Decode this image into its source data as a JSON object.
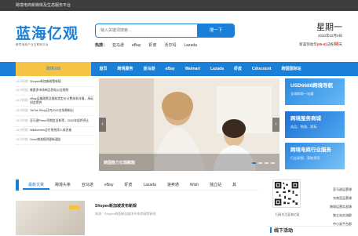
{
  "topbar": {
    "text": "跨境电商新媒体及生态服务平台"
  },
  "logo": {
    "title": "蓝海亿观",
    "subtitle": "跨境电商产业互联网平台"
  },
  "search": {
    "placeholder": "输入关键词搜索...",
    "button": "搜一下"
  },
  "hot": {
    "label": "热搜：",
    "items": [
      "亚马逊",
      "eBay",
      "虾皮",
      "沃尔玛",
      "Lazada"
    ]
  },
  "date": {
    "weekday": "星期一",
    "date": "2020年02月0日",
    "rate_prefix": "新美弥动华",
    "rate_code": "(65-6)",
    "rate_mid": "记各",
    "rate_num": "88",
    "rate_suffix": "天"
  },
  "nav": {
    "category": "跨境168",
    "items": [
      "首页",
      "跨境服务",
      "亚马逊",
      "eBay",
      "Walmart",
      "Lazada",
      "虾皮",
      "Cdiscount",
      "跨国国际站"
    ]
  },
  "leftlist": [
    {
      "time": "13小时前",
      "text": "Shopee新加坡政策新规"
    },
    {
      "time": "13小时前",
      "text": "美客多市场新品到站公告规则"
    },
    {
      "time": "13小时前",
      "text": "eBay运输政策及限制类定价计费体系详情，承诺如会提供"
    },
    {
      "time": "13小时前",
      "text": "TikTok Shop日内2022全场税新出"
    },
    {
      "time": "13小时前",
      "text": "亚马逊Prime早期会员新等，2026年起将停止"
    },
    {
      "time": "13小时前",
      "text": "Wildberries全付系统添入成名者"
    },
    {
      "time": "13小时前",
      "text": "Ozon物流规则更新通告"
    }
  ],
  "banner": {
    "caption": "跨国能力亿观赋能",
    "prev": "‹",
    "next": "›"
  },
  "promos": [
    {
      "title": "USD6688跨境导航",
      "sub": "全球跨境一站通"
    },
    {
      "title": "跨境服务商城",
      "sub": "选品、物流、商标"
    },
    {
      "title": "跨境电商行业服务",
      "sub": "行业研报、获取资讯"
    }
  ],
  "tabs": [
    "最新文章",
    "跨境头条",
    "亚马逊",
    "eBay",
    "虾皮",
    "Lazada",
    "速卖通",
    "Wish",
    "独立站",
    "其"
  ],
  "news": {
    "title": "Shopee新加坡发布新规",
    "sub": "来源：Shopee跨国新加坡发布电商政策新规"
  },
  "qr": {
    "caption": "扫码关注蓝海亿观"
  },
  "side": [
    "亚马逊运营课",
    "东南亚运营课",
    "跨境运营实战课",
    "独立站交流群",
    "中小卖平台群"
  ],
  "offline": {
    "title": "线下活动"
  },
  "colors": {
    "brand": "#1a7fd6",
    "accent": "#f6c445",
    "topbar": "#3d3d3d",
    "alert": "#e03b2b"
  }
}
